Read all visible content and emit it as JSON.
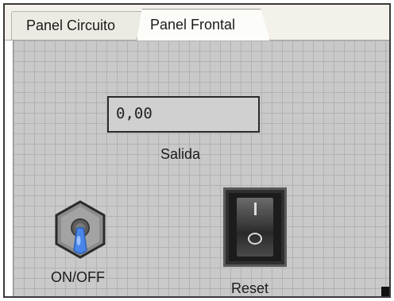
{
  "tabs": [
    {
      "label": "Panel Circuito",
      "active": false
    },
    {
      "label": "Panel Frontal",
      "active": true
    }
  ],
  "panel": {
    "display": {
      "value": "0,00",
      "label": "Salida"
    },
    "toggle_switch": {
      "label": "ON/OFF",
      "icon": "toggle-switch-icon",
      "accent": "#3f7fe0"
    },
    "rocker_switch": {
      "label": "Reset",
      "icon": "rocker-switch-icon"
    }
  },
  "colors": {
    "panel_bg": "#c9c9c9",
    "grid": "#b2b2b2",
    "tab_bar": "#f3f1e9"
  }
}
